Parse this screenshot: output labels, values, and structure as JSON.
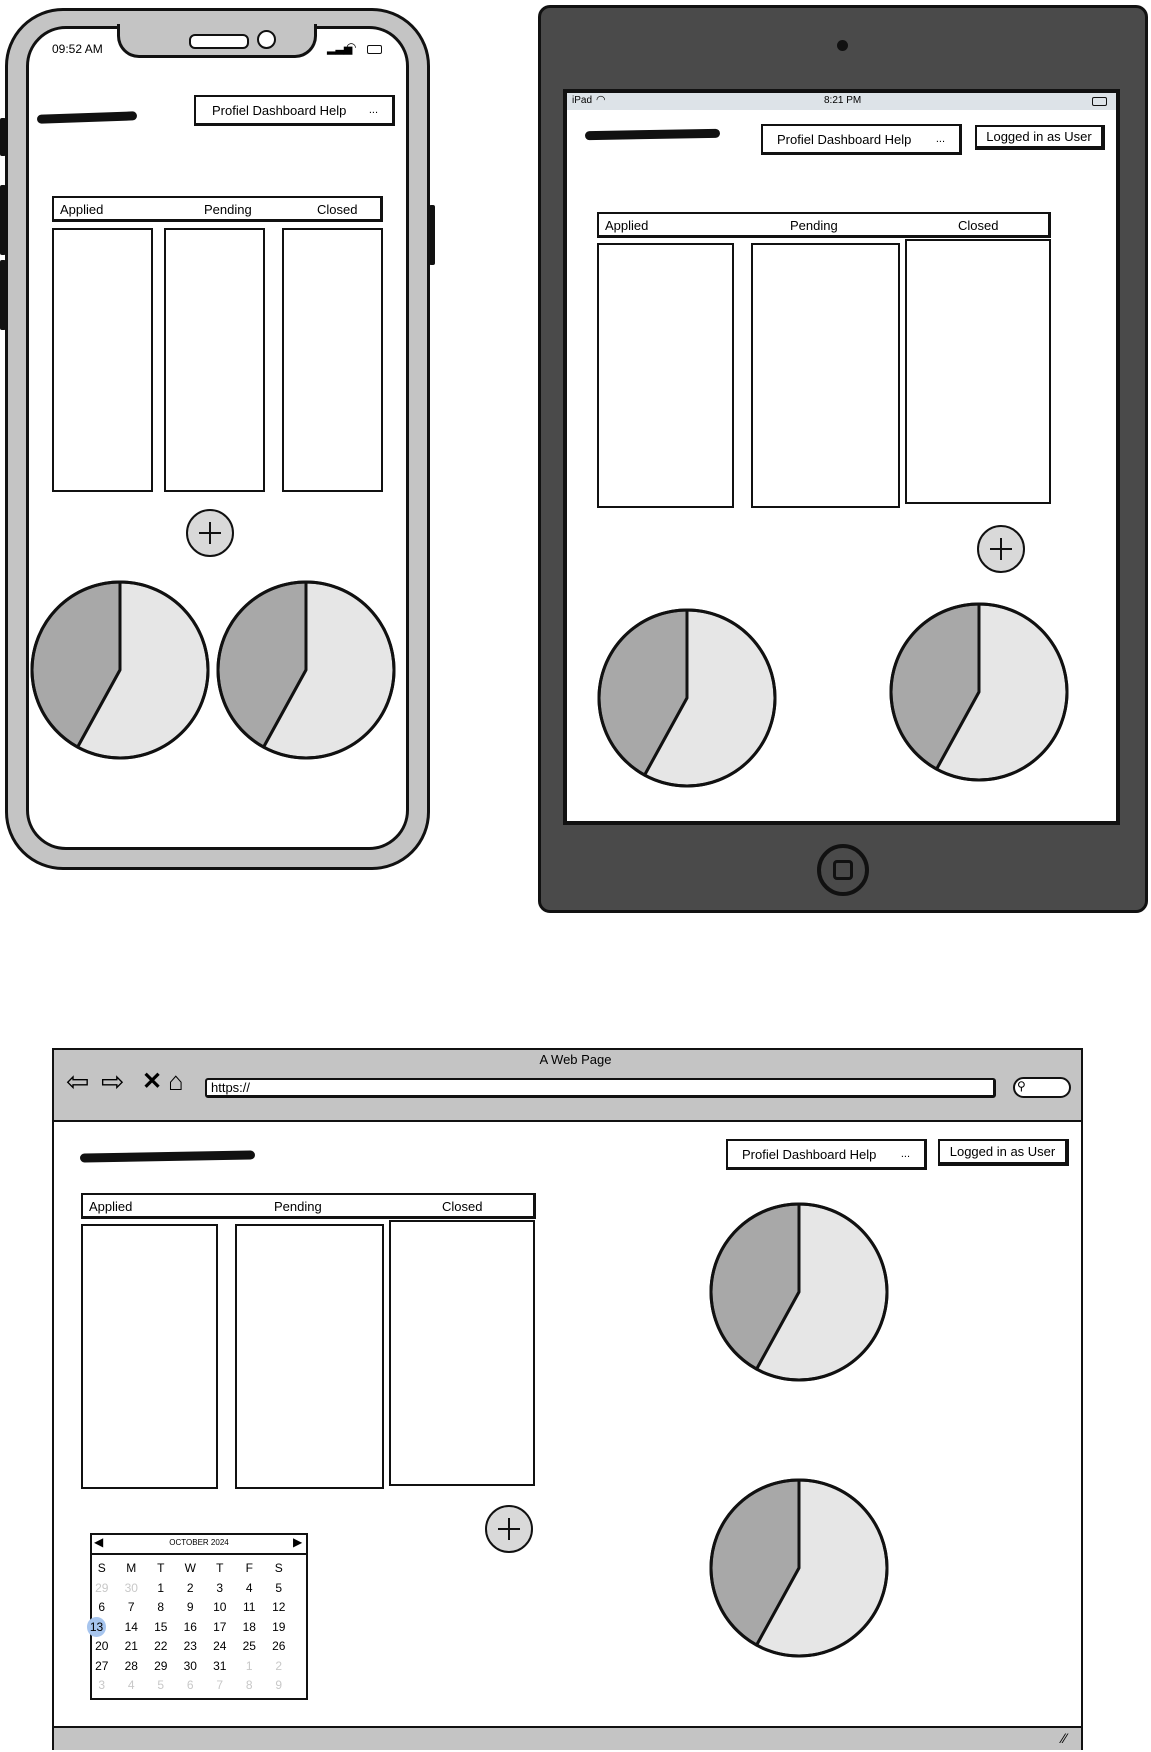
{
  "phone": {
    "status_time": "09:52 AM",
    "nav": {
      "label": "Profiel Dashboard  Help",
      "more": "..."
    },
    "columns": [
      "Applied",
      "Pending",
      "Closed"
    ]
  },
  "tablet": {
    "status_device": "iPad",
    "status_time": "8:21 PM",
    "nav": {
      "label": "Profiel Dashboard  Help",
      "more": "..."
    },
    "logged_in": "Logged in as User",
    "columns": [
      "Applied",
      "Pending",
      "Closed"
    ]
  },
  "browser": {
    "title": "A Web Page",
    "url": "https://",
    "nav": {
      "label": "Profiel Dashboard  Help",
      "more": "..."
    },
    "logged_in": "Logged in as User",
    "columns": [
      "Applied",
      "Pending",
      "Closed"
    ],
    "calendar": {
      "month": "OCTOBER 2024",
      "weekdays": [
        "S",
        "M",
        "T",
        "W",
        "T",
        "F",
        "S"
      ],
      "days": [
        [
          "29",
          "30",
          "1",
          "2",
          "3",
          "4",
          "5"
        ],
        [
          "6",
          "7",
          "8",
          "9",
          "10",
          "11",
          "12"
        ],
        [
          "13",
          "14",
          "15",
          "16",
          "17",
          "18",
          "19"
        ],
        [
          "20",
          "21",
          "22",
          "23",
          "24",
          "25",
          "26"
        ],
        [
          "27",
          "28",
          "29",
          "30",
          "31",
          "1",
          "2"
        ],
        [
          "3",
          "4",
          "5",
          "6",
          "7",
          "8",
          "9"
        ]
      ],
      "selected": "13"
    }
  },
  "pie": {
    "slices": [
      0.42,
      0.58
    ],
    "colors": [
      "#a8a8a8",
      "#e6e6e6"
    ]
  }
}
